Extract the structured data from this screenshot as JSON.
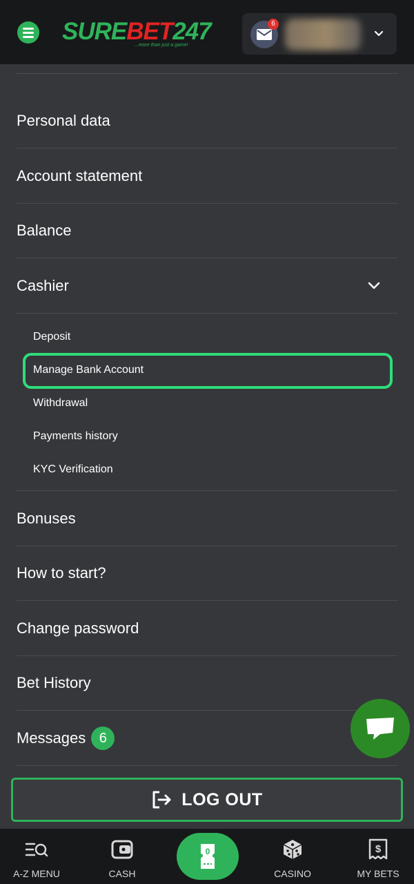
{
  "header": {
    "logo": {
      "part1": "SURE",
      "part2": "BET",
      "part3": "247"
    },
    "tagline": "...more than just a game!",
    "mail_badge": "6"
  },
  "menu": {
    "personal_data": "Personal data",
    "account_statement": "Account statement",
    "balance": "Balance",
    "cashier": "Cashier",
    "cashier_sub": {
      "deposit": "Deposit",
      "manage_bank_account": "Manage Bank Account",
      "withdrawal": "Withdrawal",
      "payments_history": "Payments history",
      "kyc_verification": "KYC Verification"
    },
    "bonuses": "Bonuses",
    "how_to_start": "How to start?",
    "change_password": "Change password",
    "bet_history": "Bet History",
    "messages": "Messages",
    "messages_count": "6"
  },
  "logout_label": "LOG OUT",
  "bottom_nav": {
    "az_menu": "A-Z MENU",
    "cash": "CASH",
    "betslip_count": "0",
    "casino": "CASINO",
    "my_bets": "MY BETS"
  },
  "colors": {
    "accent": "#2fb35a",
    "highlight": "#2fdc7a",
    "badge_red": "#e0312f",
    "background": "#36373b",
    "header_bg": "#17181a"
  }
}
